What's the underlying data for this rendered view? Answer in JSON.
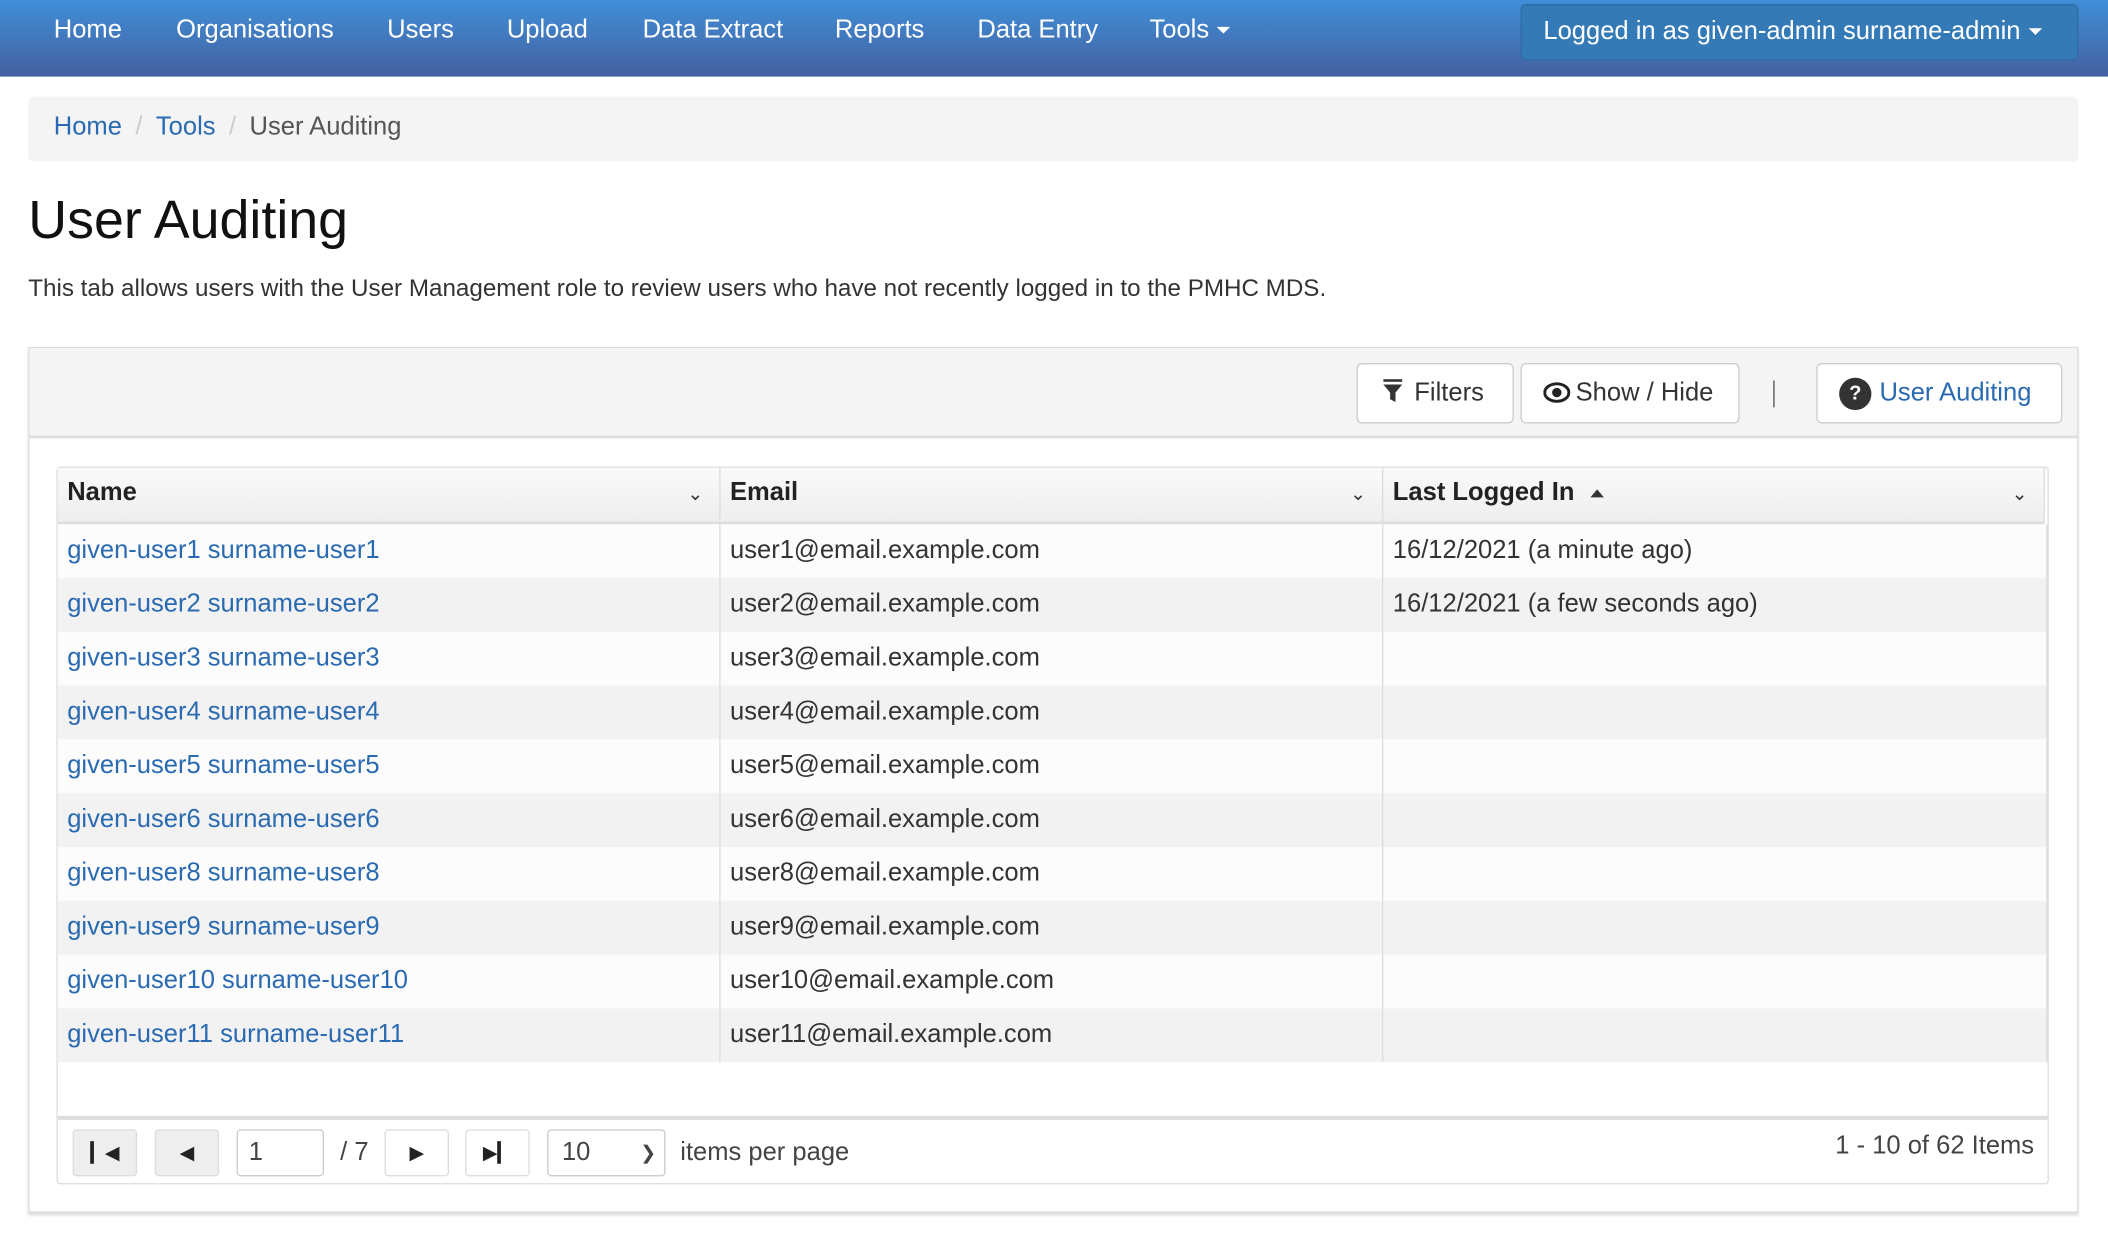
{
  "nav": {
    "items": [
      "Home",
      "Organisations",
      "Users",
      "Upload",
      "Data Extract",
      "Reports",
      "Data Entry",
      "Tools"
    ],
    "user_label": "Logged in as given-admin surname-admin"
  },
  "breadcrumb": {
    "home": "Home",
    "tools": "Tools",
    "current": "User Auditing"
  },
  "page": {
    "title": "User Auditing",
    "description": "This tab allows users with the User Management role to review users who have not recently logged in to the PMHC MDS."
  },
  "toolbar": {
    "filters": "Filters",
    "show_hide": "Show / Hide",
    "help": "User Auditing"
  },
  "grid": {
    "columns": [
      "Name",
      "Email",
      "Last Logged In"
    ],
    "sort": {
      "column": "Last Logged In",
      "direction": "ascending"
    },
    "rows": [
      {
        "name": "given-user1 surname-user1",
        "email": "user1@email.example.com",
        "last": "16/12/2021 (a minute ago)"
      },
      {
        "name": "given-user2 surname-user2",
        "email": "user2@email.example.com",
        "last": "16/12/2021 (a few seconds ago)"
      },
      {
        "name": "given-user3 surname-user3",
        "email": "user3@email.example.com",
        "last": ""
      },
      {
        "name": "given-user4 surname-user4",
        "email": "user4@email.example.com",
        "last": ""
      },
      {
        "name": "given-user5 surname-user5",
        "email": "user5@email.example.com",
        "last": ""
      },
      {
        "name": "given-user6 surname-user6",
        "email": "user6@email.example.com",
        "last": ""
      },
      {
        "name": "given-user8 surname-user8",
        "email": "user8@email.example.com",
        "last": ""
      },
      {
        "name": "given-user9 surname-user9",
        "email": "user9@email.example.com",
        "last": ""
      },
      {
        "name": "given-user10 surname-user10",
        "email": "user10@email.example.com",
        "last": ""
      },
      {
        "name": "given-user11 surname-user11",
        "email": "user11@email.example.com",
        "last": ""
      }
    ]
  },
  "pager": {
    "page": "1",
    "total_pages": "/ 7",
    "page_size": "10",
    "items_per_page": "items per page",
    "summary": "1 - 10 of 62 Items"
  },
  "colors": {
    "nav_top": "#3f8fd8",
    "nav_bottom": "#4560a0",
    "link": "#2a6ab0",
    "user_button": "#337ab7"
  }
}
